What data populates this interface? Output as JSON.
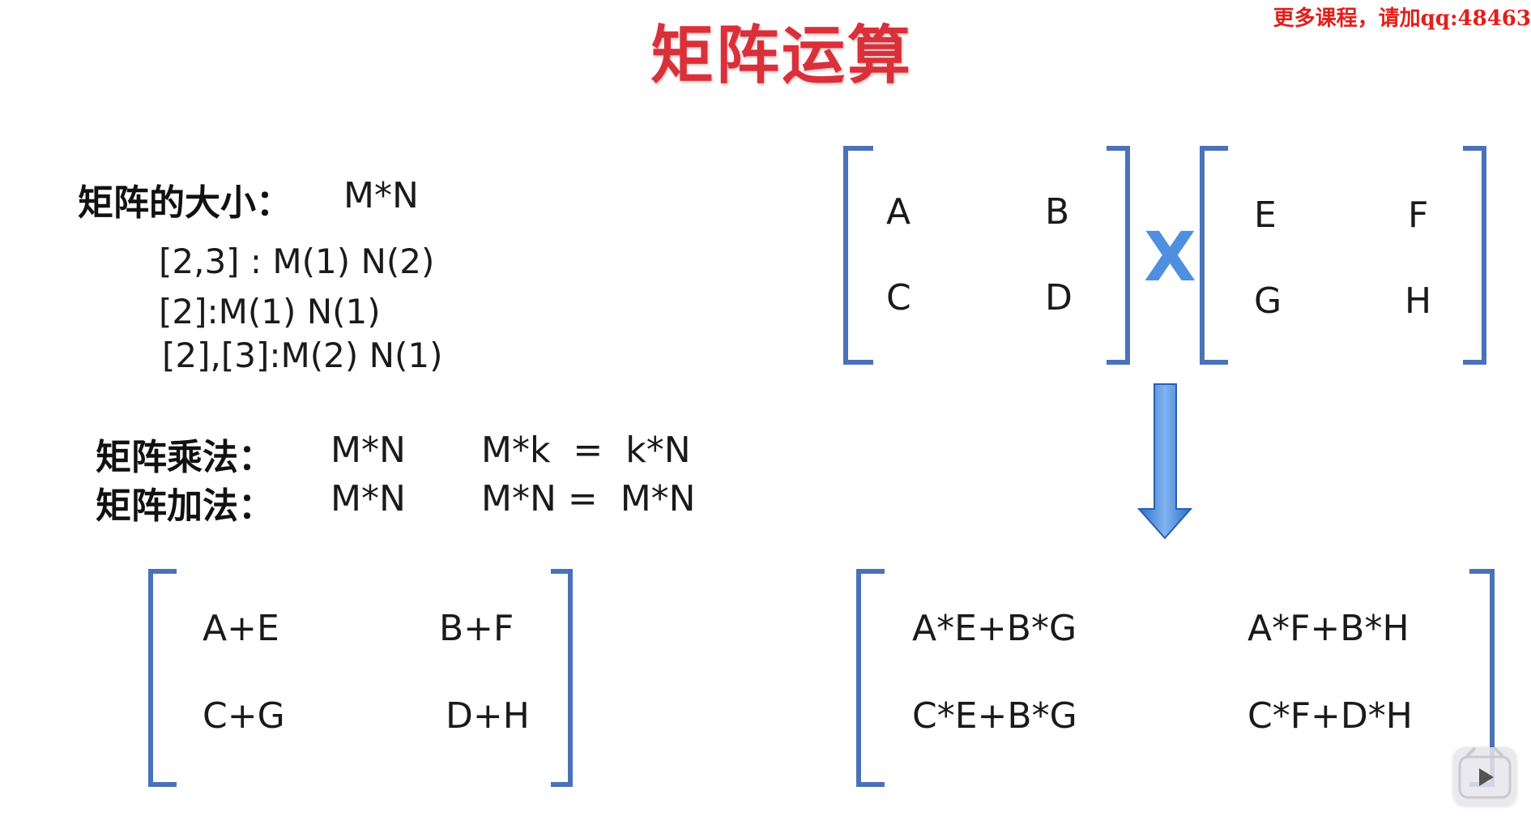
{
  "title": "矩阵运算",
  "watermark": "更多课程，请加qq:48463",
  "size_section": {
    "label": "矩阵的大小：",
    "value": "M*N",
    "examples": [
      "[2,3] : M(1)  N(2)",
      "[2]:M(1) N(1)",
      "[2],[3]:M(2) N(1)"
    ]
  },
  "multiply_rule": {
    "label": "矩阵乘法：",
    "lhs": "M*N",
    "rhs": "M*k  =  k*N"
  },
  "add_rule": {
    "label": "矩阵加法：",
    "lhs": "M*N",
    "rhs": "M*N =  M*N"
  },
  "matrix_a": [
    "A",
    "B",
    "C",
    "D"
  ],
  "times_symbol": "X",
  "matrix_b": [
    "E",
    "F",
    "G",
    "H"
  ],
  "sum_matrix": [
    "A+E",
    "B+F",
    "C+G",
    "D+H"
  ],
  "product_matrix": [
    "A*E+B*G",
    "A*F+B*H",
    "C*E+B*G",
    "C*F+D*H"
  ],
  "colors": {
    "title": "#d9303a",
    "bracket": "#4a72b8",
    "arrow": "#3a7fd6",
    "watermark": "#e0201c"
  }
}
